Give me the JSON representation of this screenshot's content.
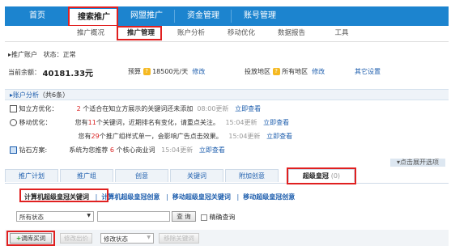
{
  "main_nav": {
    "tabs": [
      {
        "label": "首页"
      },
      {
        "label": "搜索推广"
      },
      {
        "label": "网盟推广"
      },
      {
        "label": "资金管理"
      },
      {
        "label": "账号管理"
      }
    ]
  },
  "sub_nav": {
    "items": [
      {
        "label": "推广概况"
      },
      {
        "label": "推广管理"
      },
      {
        "label": "账户分析"
      },
      {
        "label": "移动优化"
      },
      {
        "label": "数据报告"
      },
      {
        "label": "工具"
      }
    ]
  },
  "account": {
    "header": "▸推广账户",
    "status_label": "状态：",
    "status_value": "正常",
    "balance_label": "当前余额：",
    "balance_value": "40181.33元",
    "budget_label": "预算",
    "budget_value": "18500元/天",
    "budget_edit": "修改",
    "region_label": "投放地区",
    "region_value": "所有地区",
    "region_edit": "修改",
    "other_settings": "其它设置"
  },
  "analysis": {
    "header": "▸账户分析",
    "count": "（共6条）",
    "rows": [
      {
        "name": "知立方优化：",
        "p1": "2",
        "p2": " 个适合在知立方展示的关键词还未添加",
        "time": "08:00更新",
        "link": "立即查看"
      },
      {
        "name": "移动优化：",
        "p0": "您有",
        "p1": "11",
        "p2": "个关键词，近期排名有变化，请重点关注。",
        "time": "15:04更新",
        "link": "立即查看"
      },
      {
        "name": "",
        "p0": "您有",
        "p1": "29",
        "p2": "个推广组样式单一，会影响广告点击效果。",
        "time": "15:04更新",
        "link": "立即查看"
      },
      {
        "name": "钻石方案:",
        "p0": "系统为您推荐 ",
        "p1": "6",
        "p2": " 个核心商业词",
        "time": "15:04更新",
        "link": "立即查看"
      }
    ],
    "expand": "▾点击展开选项"
  },
  "ad_tabs": [
    {
      "label": "推广计划"
    },
    {
      "label": "推广组"
    },
    {
      "label": "创意"
    },
    {
      "label": "关键词"
    },
    {
      "label": "附加创意"
    },
    {
      "label": "超级皇冠",
      "count": "(0)"
    }
  ],
  "crown_links": [
    {
      "label": "计算机超级皇冠关键词"
    },
    {
      "label": "计算机超级皇冠创意"
    },
    {
      "label": "移动超级皇冠关键词"
    },
    {
      "label": "移动超级皇冠创意"
    }
  ],
  "filter": {
    "status_select": "所有状态",
    "search_button": "查 询",
    "exact_label": "精确查询"
  },
  "actions": {
    "adjust_button": "调库买词",
    "bid_button": "修改出价",
    "status_select": "修改状态",
    "remove_button": "移除关键词"
  },
  "colors": {
    "nav_blue": "#1c84cf",
    "highlight_red": "#e02020",
    "link_blue": "#1f5fae"
  }
}
